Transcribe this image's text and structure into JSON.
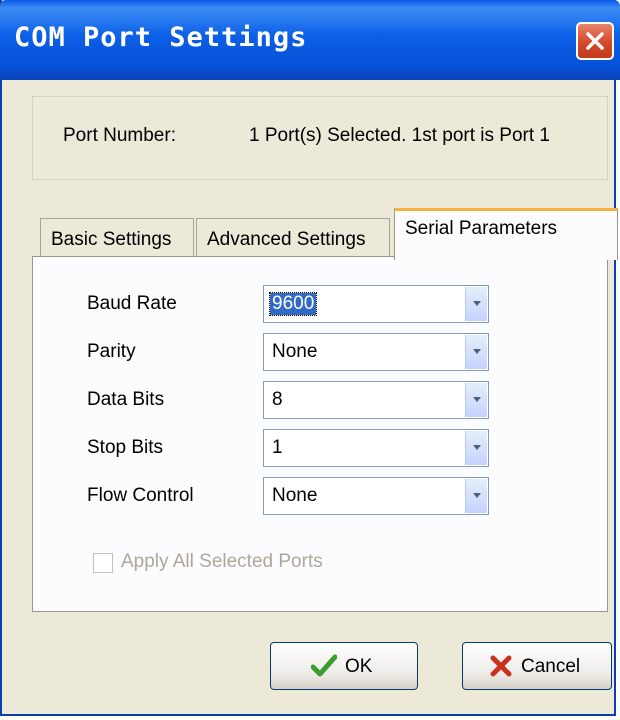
{
  "window": {
    "title": "COM Port Settings",
    "title_color": "#ffffff",
    "titlebar_color": "#0b5fe6",
    "close_icon": "close-icon"
  },
  "port": {
    "label": "Port Number:",
    "value": "1 Port(s) Selected. 1st port is Port 1"
  },
  "tabs": [
    {
      "label": "Basic Settings",
      "active": false
    },
    {
      "label": "Advanced Settings",
      "active": false
    },
    {
      "label": "Serial Parameters",
      "active": true
    }
  ],
  "serial": {
    "fields": [
      {
        "label": "Baud Rate",
        "value": "9600",
        "selected": true
      },
      {
        "label": "Parity",
        "value": "None",
        "selected": false
      },
      {
        "label": "Data Bits",
        "value": "8",
        "selected": false
      },
      {
        "label": "Stop Bits",
        "value": "1",
        "selected": false
      },
      {
        "label": "Flow Control",
        "value": "None",
        "selected": false
      }
    ],
    "apply_all": {
      "label": "Apply All Selected Ports",
      "checked": false,
      "enabled": false
    }
  },
  "buttons": {
    "ok": {
      "label": "OK",
      "icon": "checkmark-icon",
      "icon_color": "#3a9c2a"
    },
    "cancel": {
      "label": "Cancel",
      "icon": "x-icon",
      "icon_color": "#c8321e"
    }
  }
}
